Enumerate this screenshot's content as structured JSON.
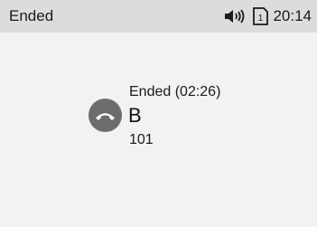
{
  "status_bar": {
    "title": "Ended",
    "time": "20:14",
    "sim_slot": "1",
    "speaker_icon": "speaker-volume-icon",
    "sim_icon": "sim-card-icon"
  },
  "call": {
    "status": "Ended",
    "duration": "(02:26)",
    "status_text": "Ended  (02:26)",
    "name": "B",
    "number": "101",
    "icon": "hang-up-phone-icon"
  },
  "colors": {
    "status_bar_bg": "#dcdcdc",
    "screen_bg": "#f2f2f2",
    "avatar_bg": "#6d6d6d",
    "text": "#1a1a1a"
  }
}
